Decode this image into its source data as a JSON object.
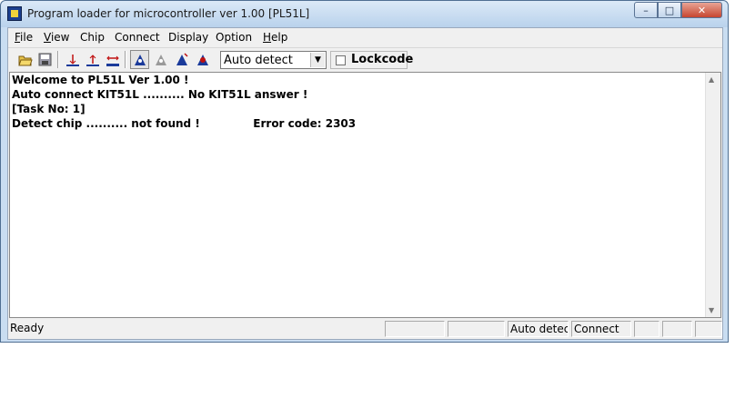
{
  "window": {
    "title": "Program loader for microcontroller ver 1.00 [PL51L]"
  },
  "menu": {
    "items": [
      "File",
      "View",
      "Chip",
      "Connect",
      "Display",
      "Option",
      "Help"
    ]
  },
  "toolbar": {
    "icons": [
      "open-folder-icon",
      "save-icon",
      "read-chip-icon",
      "write-chip-icon",
      "erase-chip-icon",
      "task-1-icon",
      "task-2-icon",
      "task-3-icon",
      "task-4-icon"
    ],
    "device_select": "Auto detect",
    "lockcode_label": "Lockcode",
    "lockcode_checked": false
  },
  "log": {
    "lines": [
      "Welcome to PL51L Ver 1.00 !",
      "Auto connect KIT51L .......... No KIT51L answer !",
      "[Task No: 1]",
      "Detect chip .......... not found !              Error code: 2303"
    ]
  },
  "status": {
    "text": "Ready",
    "panels": [
      "",
      "",
      "Auto detect",
      "Connect",
      "",
      "",
      ""
    ]
  },
  "colors": {
    "title_bar": "#c9ddf1",
    "close_button": "#c7452f"
  }
}
